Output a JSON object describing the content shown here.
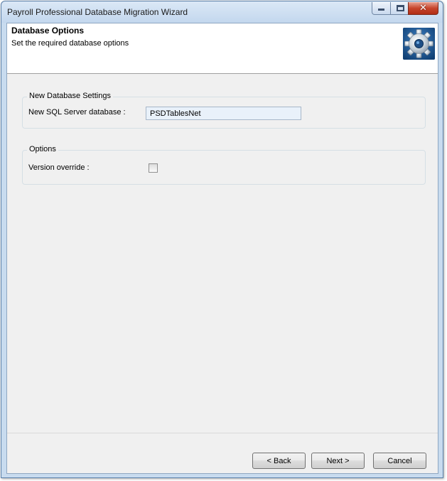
{
  "window": {
    "title": "Payroll Professional Database Migration Wizard",
    "caption_buttons": {
      "minimize_icon": "minimize-icon",
      "maximize_icon": "maximize-icon",
      "close_icon": "close-icon",
      "close_glyph": "✕"
    }
  },
  "header": {
    "title": "Database Options",
    "subtitle": "Set the required database options",
    "logo_icon": "gear-icon"
  },
  "new_db_group": {
    "legend": "New Database Settings",
    "db_label": "New SQL Server database :",
    "db_value": "PSDTablesNet"
  },
  "options_group": {
    "legend": "Options",
    "version_label": "Version override :",
    "version_checked": false
  },
  "buttons": {
    "back": "< Back",
    "next": "Next >",
    "cancel": "Cancel"
  },
  "colors": {
    "accent": "#1d5a98",
    "input_bg": "#e9f1fa",
    "close_button": "#c7452c"
  }
}
